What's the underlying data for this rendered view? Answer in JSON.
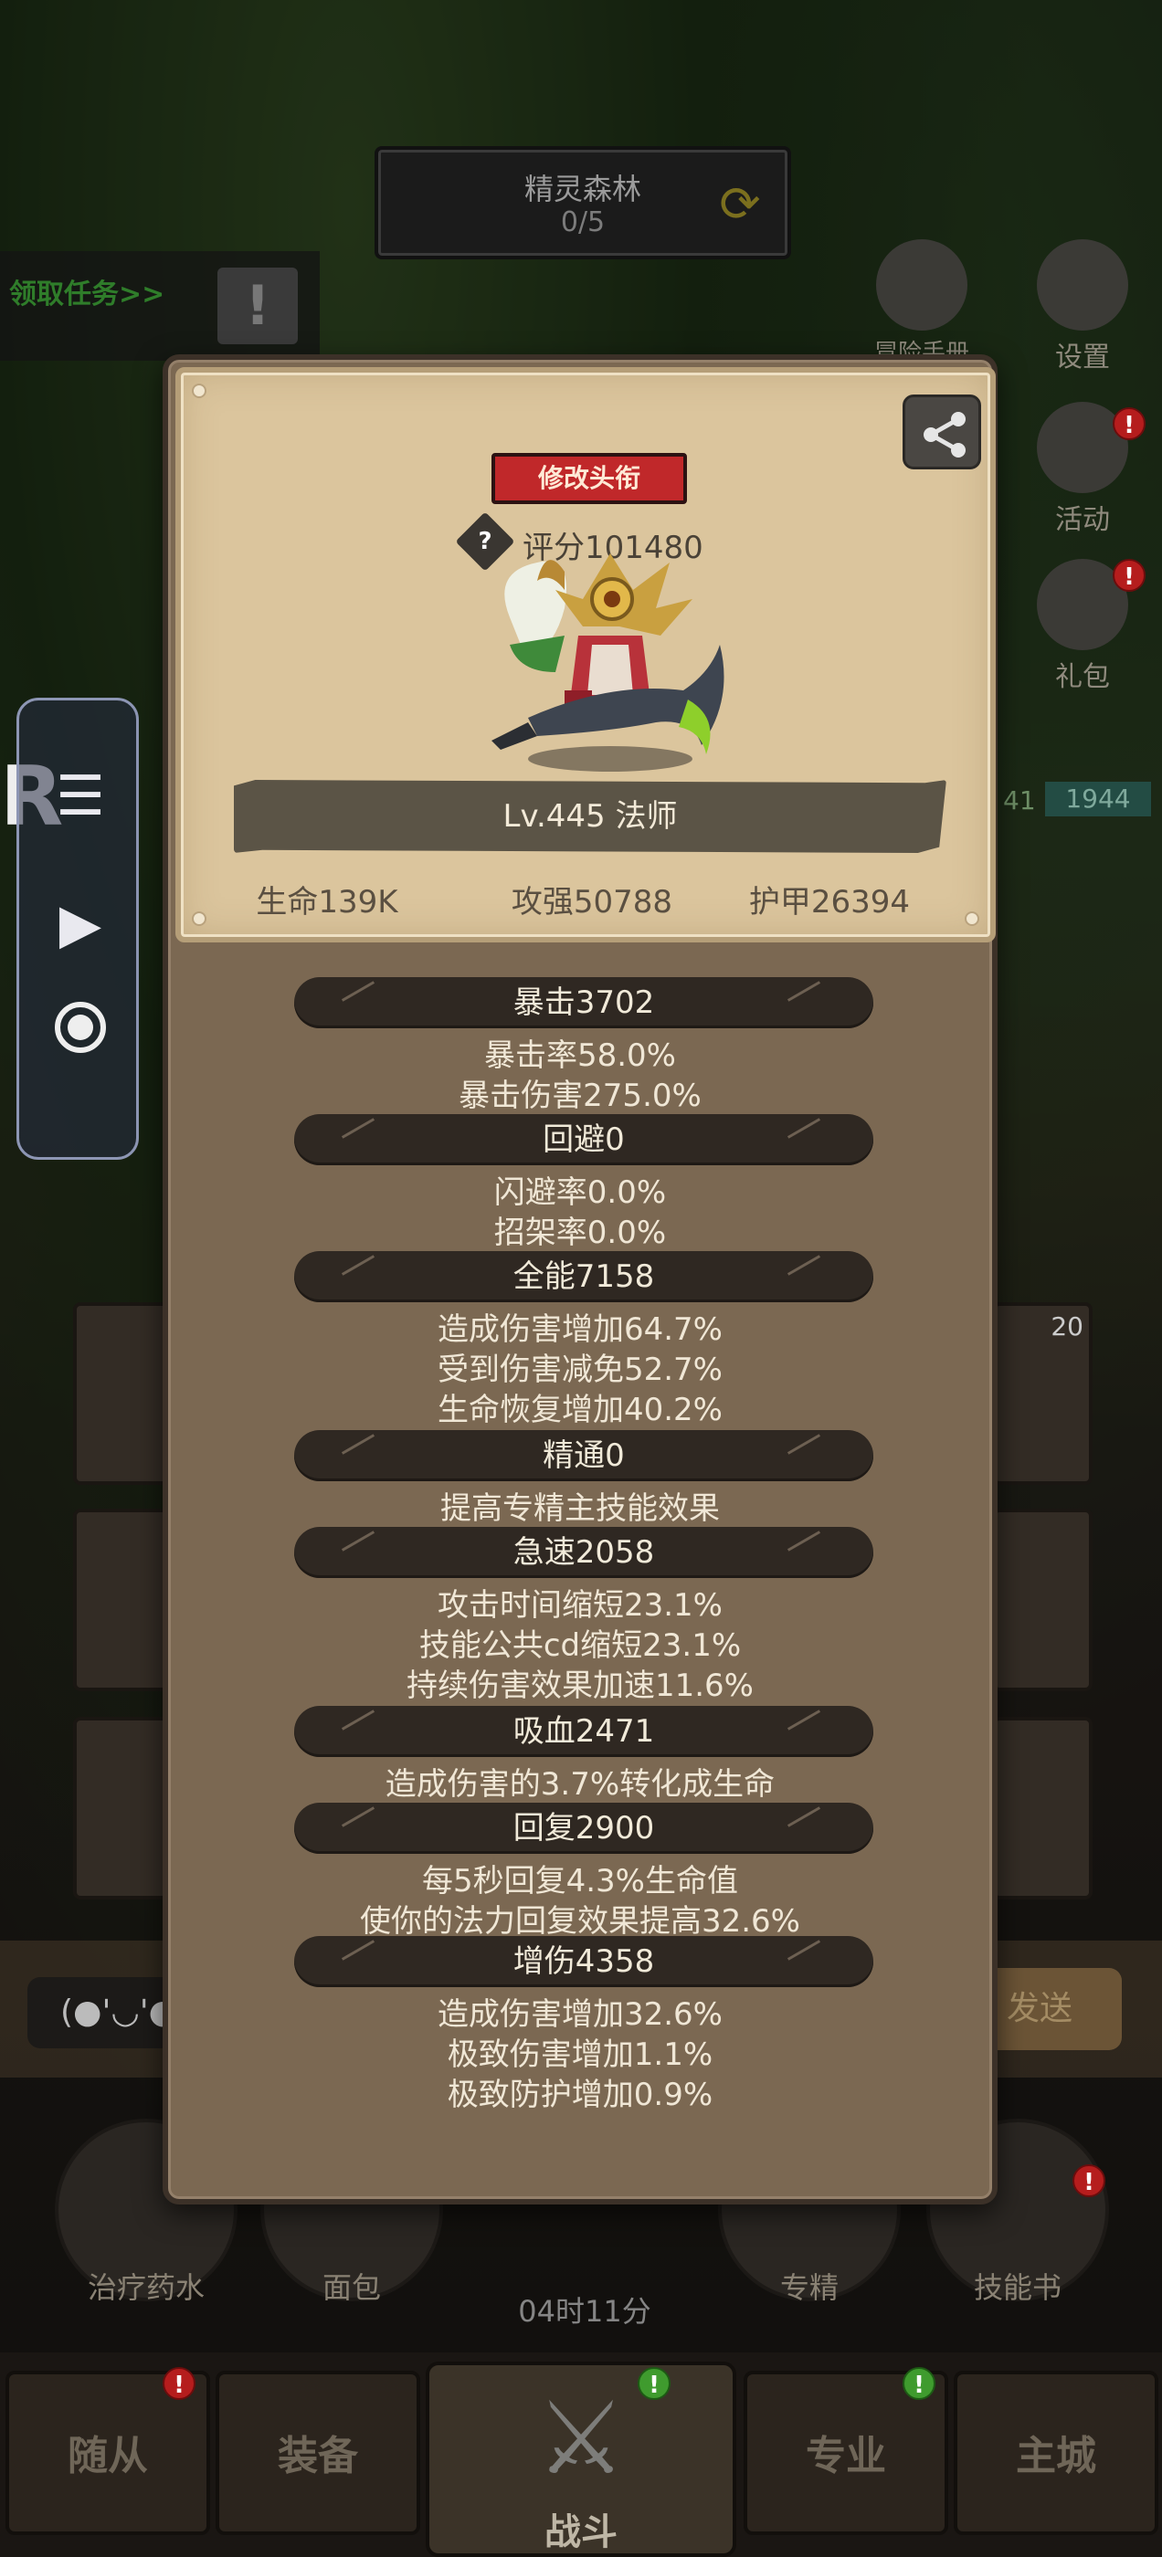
{
  "top_banner": {
    "title": "精灵森林",
    "progress": "0/5"
  },
  "task_bar": {
    "label": "领取任务>>"
  },
  "right_icons": [
    {
      "label": "冒险手册"
    },
    {
      "label": "设置"
    },
    {
      "label": "活动"
    },
    {
      "label": "礼包"
    }
  ],
  "profile": {
    "title_button": "修改头衔",
    "score": "评分101480",
    "level_text": "Lv.445 法师",
    "core_stats": [
      "生命139K",
      "攻强50788",
      "护甲26394"
    ]
  },
  "stat_groups": [
    {
      "header": "暴击3702",
      "lines": [
        "暴击率58.0%",
        "暴击伤害275.0%"
      ]
    },
    {
      "header": "回避0",
      "lines": [
        "闪避率0.0%",
        "招架率0.0%"
      ]
    },
    {
      "header": "全能7158",
      "lines": [
        "造成伤害增加64.7%",
        "受到伤害减免52.7%",
        "生命恢复增加40.2%"
      ]
    },
    {
      "header": "精通0",
      "lines": [
        "提高专精主技能效果"
      ]
    },
    {
      "header": "急速2058",
      "lines": [
        "攻击时间缩短23.1%",
        "技能公共cd缩短23.1%",
        "持续伤害效果加速11.6%"
      ]
    },
    {
      "header": "吸血2471",
      "lines": [
        "造成伤害的3.7%转化成生命"
      ]
    },
    {
      "header": "回复2900",
      "lines": [
        "每5秒回复4.3%生命值",
        "使你的法力回复效果提高32.6%"
      ]
    },
    {
      "header": "增伤4358",
      "lines": [
        "造成伤害增加32.6%",
        "极致伤害增加1.1%",
        "极致防护增加0.9%"
      ]
    }
  ],
  "background_numbers": {
    "left": "41",
    "right": "1944",
    "slot_count": "20"
  },
  "chat": {
    "emoji": "(●'◡'●",
    "send": "发送"
  },
  "consumables": [
    "治疗药水",
    "面包",
    "专精",
    "技能书"
  ],
  "timer": "04时11分",
  "nav": {
    "tabs": [
      "随从",
      "装备",
      "专业",
      "主城"
    ],
    "center": "战斗"
  },
  "colors": {
    "modal_bg": "#7b6852",
    "card_bg": "#dbc59d",
    "title_btn": "#c0282a",
    "stat_head": "#2f2822"
  }
}
